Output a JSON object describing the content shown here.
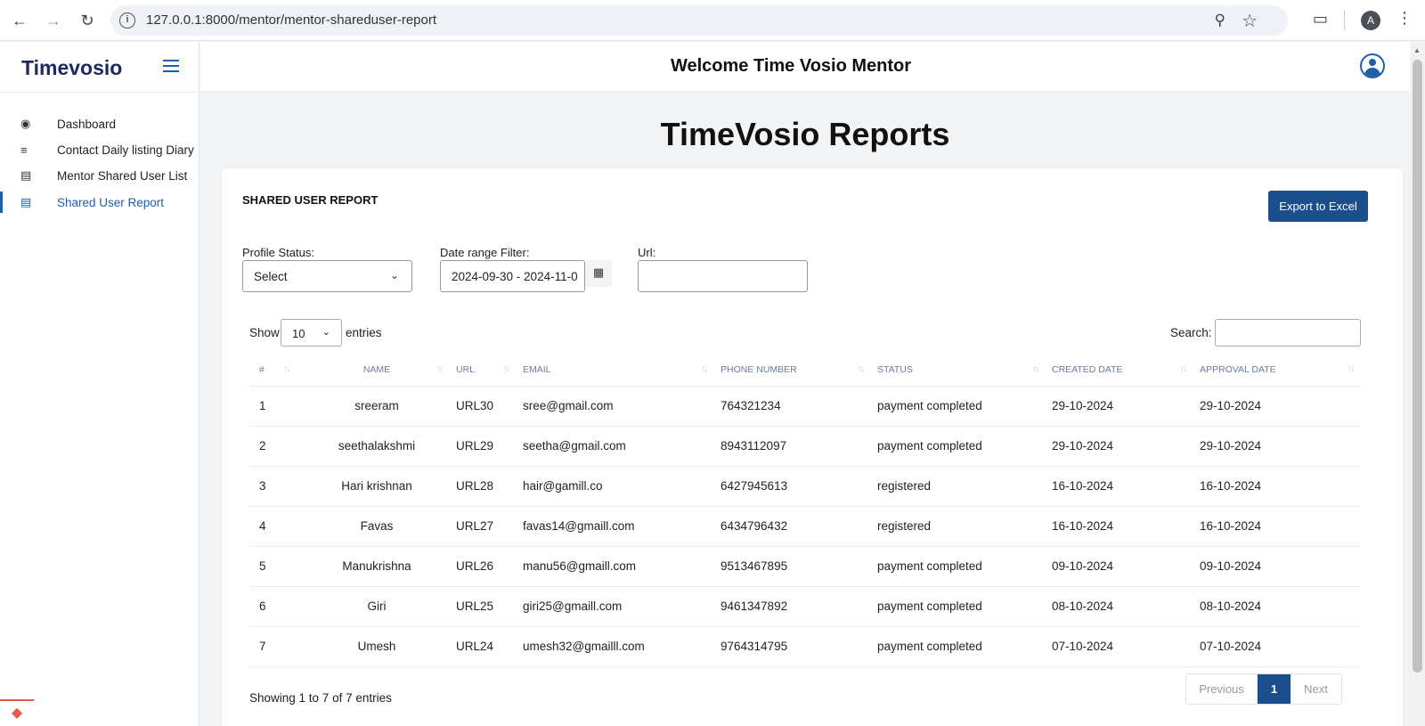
{
  "browser": {
    "url": "127.0.0.1:8000/mentor/mentor-shareduser-report",
    "profile_initial": "A"
  },
  "sidebar": {
    "brand": "Timevosio",
    "items": [
      {
        "label": "Dashboard",
        "icon": "speedometer-icon",
        "active": false
      },
      {
        "label": "Contact Daily listing Diary",
        "icon": "list-icon",
        "active": false
      },
      {
        "label": "Mentor Shared User List",
        "icon": "table-icon",
        "active": false
      },
      {
        "label": "Shared User Report",
        "icon": "table-icon",
        "active": true
      }
    ]
  },
  "header": {
    "welcome": "Welcome Time Vosio Mentor"
  },
  "page": {
    "title": "TimeVosio Reports"
  },
  "report": {
    "card_title": "SHARED USER REPORT",
    "export_label": "Export to Excel",
    "filters": {
      "profile_status_label": "Profile Status:",
      "profile_status_value": "Select",
      "date_range_label": "Date range Filter:",
      "date_range_value": "2024-09-30 - 2024-11-0",
      "url_label": "Url:",
      "url_value": ""
    },
    "length": {
      "show_label": "Show",
      "value": "10",
      "entries_label": "entries"
    },
    "search_label": "Search:",
    "columns": [
      "#",
      "NAME",
      "URL",
      "EMAIL",
      "PHONE NUMBER",
      "STATUS",
      "CREATED DATE",
      "APPROVAL DATE"
    ],
    "rows": [
      {
        "idx": "1",
        "name": "sreeram",
        "url": "URL30",
        "email": "sree@gmail.com",
        "phone": "764321234",
        "status": "payment completed",
        "created": "29-10-2024",
        "approval": "29-10-2024"
      },
      {
        "idx": "2",
        "name": "seethalakshmi",
        "url": "URL29",
        "email": "seetha@gmail.com",
        "phone": "8943112097",
        "status": "payment completed",
        "created": "29-10-2024",
        "approval": "29-10-2024"
      },
      {
        "idx": "3",
        "name": "Hari krishnan",
        "url": "URL28",
        "email": "hair@gamill.co",
        "phone": "6427945613",
        "status": "registered",
        "created": "16-10-2024",
        "approval": "16-10-2024"
      },
      {
        "idx": "4",
        "name": "Favas",
        "url": "URL27",
        "email": "favas14@gmaill.com",
        "phone": "6434796432",
        "status": "registered",
        "created": "16-10-2024",
        "approval": "16-10-2024"
      },
      {
        "idx": "5",
        "name": "Manukrishna",
        "url": "URL26",
        "email": "manu56@gmaill.com",
        "phone": "9513467895",
        "status": "payment completed",
        "created": "09-10-2024",
        "approval": "09-10-2024"
      },
      {
        "idx": "6",
        "name": "Giri",
        "url": "URL25",
        "email": "giri25@gmaill.com",
        "phone": "9461347892",
        "status": "payment completed",
        "created": "08-10-2024",
        "approval": "08-10-2024"
      },
      {
        "idx": "7",
        "name": "Umesh",
        "url": "URL24",
        "email": "umesh32@gmailll.com",
        "phone": "9764314795",
        "status": "payment completed",
        "created": "07-10-2024",
        "approval": "07-10-2024"
      }
    ],
    "info": "Showing 1 to 7 of 7 entries",
    "pagination": {
      "previous": "Previous",
      "current": "1",
      "next": "Next"
    }
  },
  "colors": {
    "brand": "#1b2a5a",
    "accent": "#1a4e8c",
    "active_link": "#1f5fa8"
  }
}
